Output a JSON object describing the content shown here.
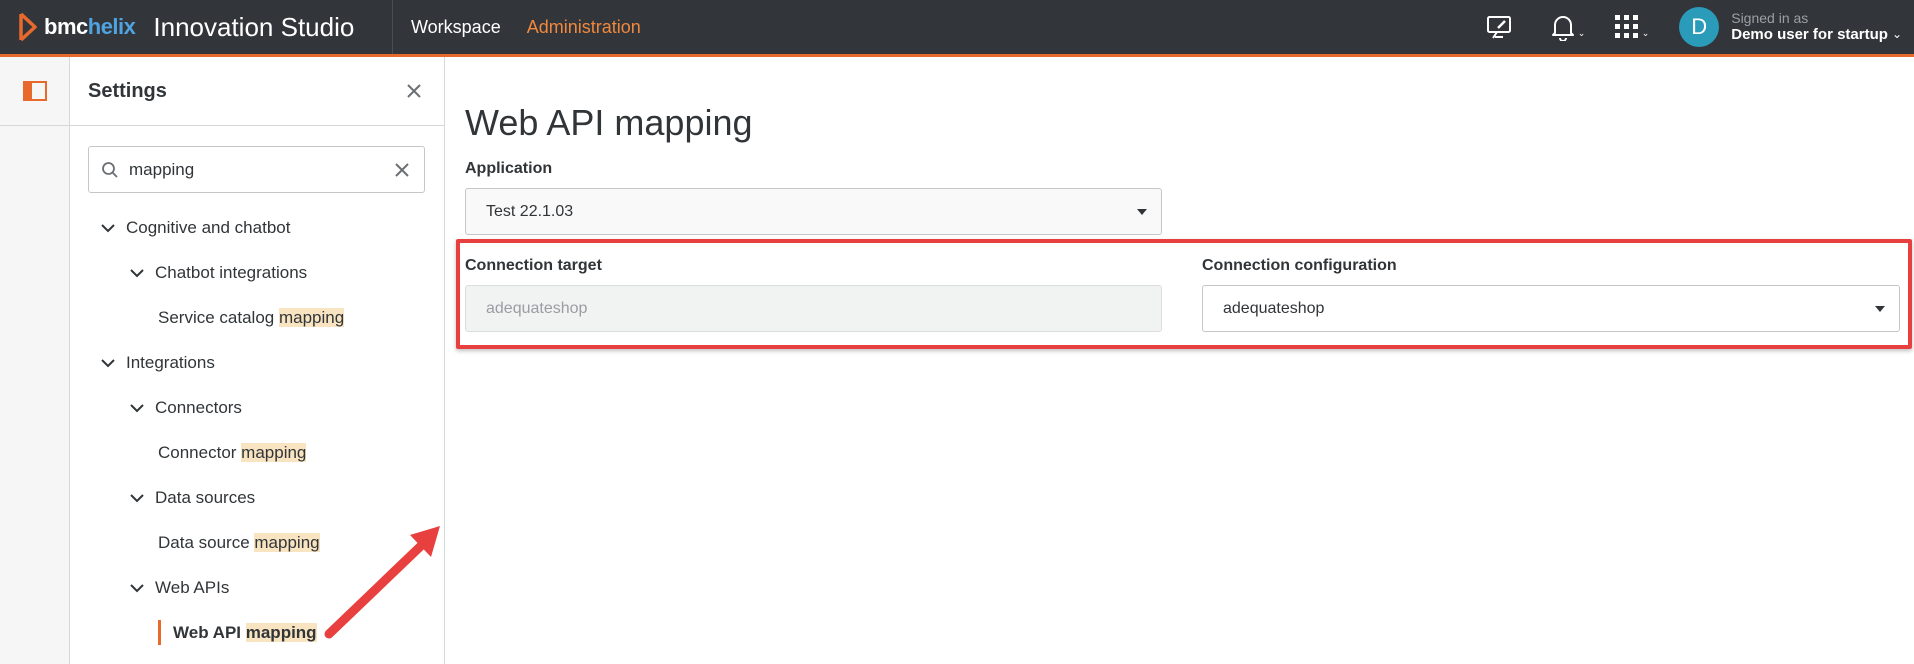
{
  "header": {
    "brand_bmc": "bmc",
    "brand_helix": "helix",
    "product": "Innovation Studio",
    "nav": [
      {
        "label": "Workspace"
      },
      {
        "label": "Administration"
      }
    ],
    "signed_in_label": "Signed in as",
    "user_name": "Demo user for startup",
    "avatar_initial": "D"
  },
  "settings": {
    "title": "Settings",
    "search_value": "mapping",
    "tree": {
      "cognitive": "Cognitive and chatbot",
      "chatbot_integrations": "Chatbot integrations",
      "service_catalog_prefix": "Service catalog ",
      "integrations": "Integrations",
      "connectors": "Connectors",
      "connector_prefix": "Connector ",
      "data_sources": "Data sources",
      "data_source_prefix": "Data source ",
      "web_apis": "Web APIs",
      "web_api_prefix": "Web API ",
      "match": "mapping"
    }
  },
  "main": {
    "title": "Web API mapping",
    "application_label": "Application",
    "application_value": "Test 22.1.03",
    "connection_target_label": "Connection target",
    "connection_target_value": "adequateshop",
    "connection_config_label": "Connection configuration",
    "connection_config_value": "adequateshop"
  },
  "colors": {
    "accent": "#e8692c",
    "topbar": "#323539",
    "highlight": "#f9e4c2",
    "annotation": "#e8403f"
  }
}
